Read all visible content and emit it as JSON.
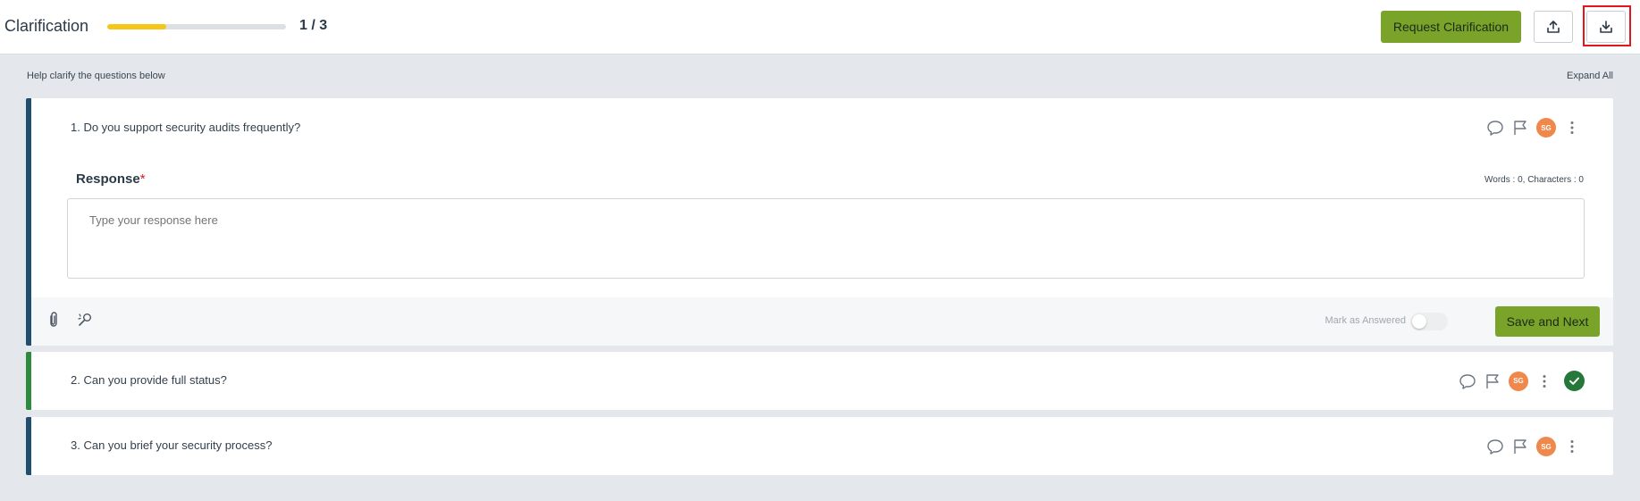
{
  "header": {
    "title": "Clarification",
    "progress": {
      "current": 1,
      "total": 3,
      "fraction": 0.33,
      "label": "1 / 3"
    },
    "request_button": "Request Clarification",
    "upload_icon": "upload-icon",
    "download_icon": "download-icon"
  },
  "subheader": {
    "help_text": "Help clarify the questions below",
    "expand_all": "Expand All"
  },
  "questions": [
    {
      "text": "1. Do you support security audits frequently?",
      "avatar": "SG",
      "expanded": true,
      "response_label": "Response",
      "required_mark": "*",
      "counter": "Words : 0, Characters : 0",
      "placeholder": "Type your response here",
      "mark_answered_label": "Mark as Answered",
      "mark_answered": false,
      "save_button": "Save and Next"
    },
    {
      "text": "2. Can you provide full status?",
      "avatar": "SG",
      "answered": true
    },
    {
      "text": "3. Can you brief your security process?",
      "avatar": "SG"
    }
  ],
  "colors": {
    "accent_green": "#79a429",
    "progress_yellow": "#f5c518",
    "border_navy": "#1f4e6e",
    "border_green": "#2e8b3e",
    "avatar_orange": "#f0884b",
    "highlight_red": "#e2171c"
  }
}
